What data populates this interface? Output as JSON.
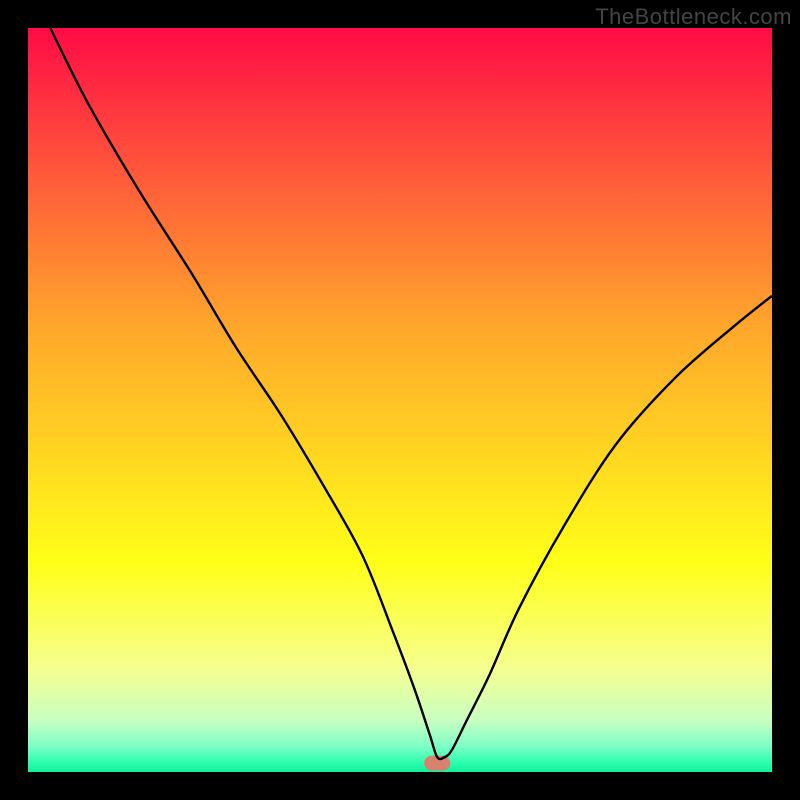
{
  "watermark": "TheBottleneck.com",
  "chart_data": {
    "type": "line",
    "title": "",
    "xlabel": "",
    "ylabel": "",
    "xlim": [
      0,
      100
    ],
    "ylim": [
      0,
      100
    ],
    "marker": {
      "x": 55,
      "y": 1.2,
      "w": 3.5,
      "h": 2.0
    },
    "series": [
      {
        "name": "curve",
        "x": [
          3,
          8,
          15,
          22,
          28,
          34,
          40,
          45,
          49,
          52,
          54,
          55,
          56,
          57,
          59,
          62,
          66,
          72,
          79,
          87,
          95,
          100
        ],
        "y": [
          100,
          90,
          78,
          67,
          57,
          48,
          38,
          29,
          19,
          11,
          5,
          2,
          2,
          3,
          7,
          13,
          22,
          33,
          44,
          53,
          60,
          64
        ]
      }
    ],
    "gradient_bands": [
      {
        "stop": 0.0,
        "color": "#ff0b46"
      },
      {
        "stop": 0.2,
        "color": "#ff5a3a"
      },
      {
        "stop": 0.4,
        "color": "#ffa62c"
      },
      {
        "stop": 0.58,
        "color": "#ffd820"
      },
      {
        "stop": 0.72,
        "color": "#ffff18"
      },
      {
        "stop": 0.86,
        "color": "#f6ff8f"
      },
      {
        "stop": 0.93,
        "color": "#c9ffc0"
      },
      {
        "stop": 0.965,
        "color": "#7fffc8"
      },
      {
        "stop": 0.985,
        "color": "#34ffb0"
      },
      {
        "stop": 1.0,
        "color": "#0ef29a"
      }
    ]
  }
}
